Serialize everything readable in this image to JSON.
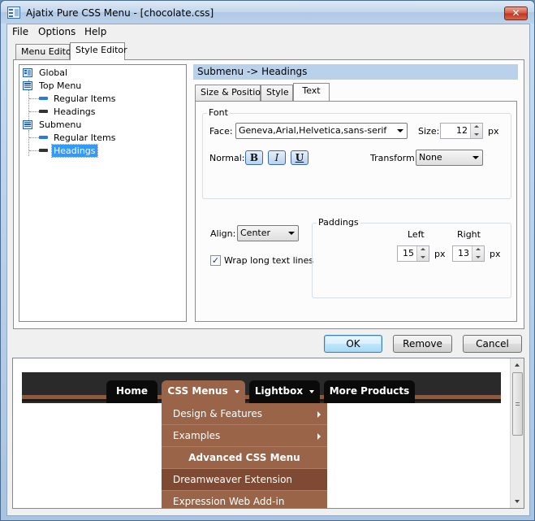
{
  "window": {
    "title": "Ajatix Pure CSS Menu - [chocolate.css]",
    "close_glyph": "✕"
  },
  "menubar": {
    "items": [
      "File",
      "Options",
      "Help"
    ]
  },
  "main_tabs": [
    "Menu Editor",
    "Style Editor"
  ],
  "tree": {
    "items": [
      "Global",
      "Top Menu",
      "Regular Items",
      "Headings",
      "Submenu",
      "Regular Items",
      "Headings"
    ],
    "selected": "Headings"
  },
  "pane": {
    "header": "Submenu -> Headings",
    "tabs": [
      "Size & Position",
      "Style",
      "Text"
    ],
    "font": {
      "group_label": "Font",
      "face_label": "Face:",
      "face_value": "Geneva,Arial,Helvetica,sans-serif",
      "size_label": "Size:",
      "size_value": "12",
      "size_unit": "px",
      "normal_label": "Normal:",
      "bold": "B",
      "italic": "I",
      "underline": "U",
      "transform_label": "Transform:",
      "transform_value": "None"
    },
    "align_label": "Align:",
    "align_value": "Center",
    "wrap_label": "Wrap long text lines",
    "wrap_checked": true,
    "check_glyph": "✓",
    "paddings": {
      "group_label": "Paddings",
      "left_label": "Left",
      "right_label": "Right",
      "left_value": "15",
      "right_value": "13",
      "unit": "px"
    }
  },
  "buttons": {
    "ok": "OK",
    "remove": "Remove",
    "cancel": "Cancel"
  },
  "preview": {
    "menu": [
      "Home",
      "CSS Menus",
      "Lightbox",
      "More Products"
    ],
    "dropdown": [
      "Design & Features",
      "Examples",
      "Advanced CSS Menu",
      "Dreamweaver Extension",
      "Expression Web Add-in"
    ],
    "colors": {
      "bar": "#2a2a2a",
      "item": "#0a0a0a",
      "active": "#9a6448",
      "hover": "#7e4a33"
    }
  }
}
